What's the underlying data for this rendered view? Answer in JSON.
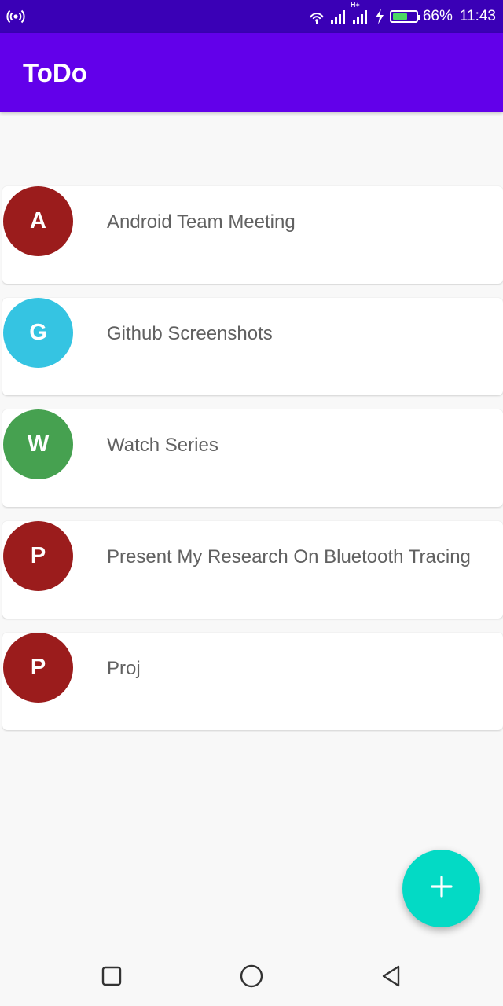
{
  "status_bar": {
    "battery_percent": "66%",
    "battery_level": 0.66,
    "battery_color": "#4cd964",
    "time": "11:43",
    "network_type": "H+",
    "icons": [
      "hotspot-icon",
      "wifi-icon",
      "signal-icon",
      "signal-icon",
      "charging-icon",
      "battery-icon"
    ]
  },
  "app_bar": {
    "title": "ToDo",
    "color": "#6200ea"
  },
  "todos": [
    {
      "initial": "A",
      "title": "Android Team Meeting",
      "color": "#9b1c1c"
    },
    {
      "initial": "G",
      "title": "Github Screenshots",
      "color": "#35c4e2"
    },
    {
      "initial": "W",
      "title": "Watch Series",
      "color": "#46a150"
    },
    {
      "initial": "P",
      "title": "Present My Research On Bluetooth Tracing",
      "color": "#9b1c1c"
    },
    {
      "initial": "P",
      "title": "Proj",
      "color": "#9b1c1c"
    }
  ],
  "fab": {
    "icon": "plus-icon",
    "color": "#03dac5"
  },
  "nav_bar": {
    "icons": [
      "recents-square-icon",
      "home-circle-icon",
      "back-triangle-icon"
    ]
  }
}
